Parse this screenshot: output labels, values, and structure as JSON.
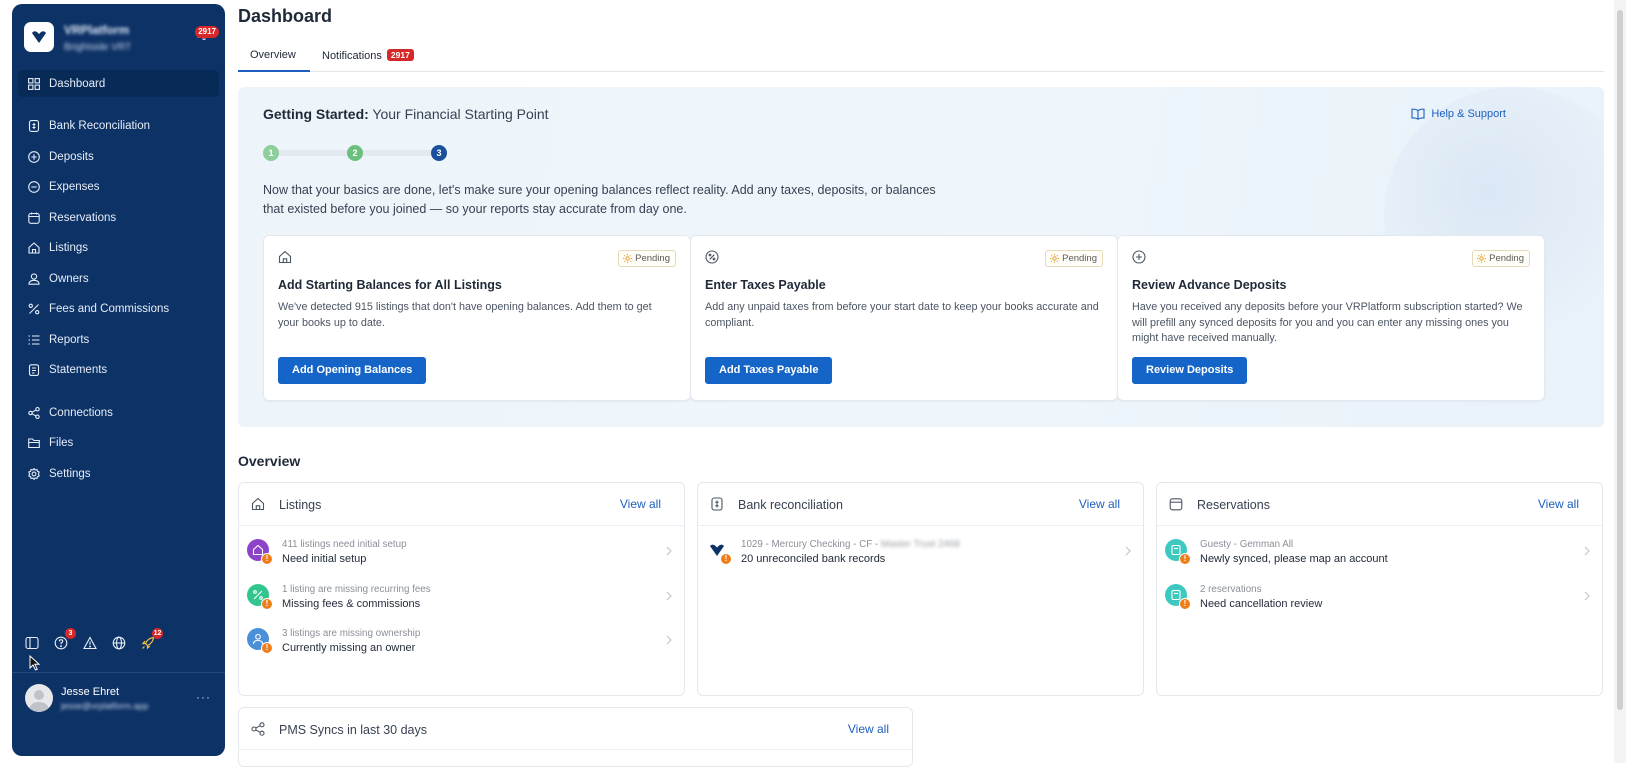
{
  "brand": {
    "name": "VRPlatform",
    "subtitle": "Brightside VRT",
    "bell_badge": "2917"
  },
  "sidebar": {
    "items": [
      {
        "label": "Dashboard",
        "icon": "grid-icon",
        "active": true
      },
      {
        "label": "Bank Reconciliation",
        "icon": "bank-icon"
      },
      {
        "label": "Deposits",
        "icon": "plus-circle-icon"
      },
      {
        "label": "Expenses",
        "icon": "minus-circle-icon"
      },
      {
        "label": "Reservations",
        "icon": "calendar-icon"
      },
      {
        "label": "Listings",
        "icon": "home-icon"
      },
      {
        "label": "Owners",
        "icon": "user-icon"
      },
      {
        "label": "Fees and Commissions",
        "icon": "percent-icon"
      },
      {
        "label": "Reports",
        "icon": "list-icon"
      },
      {
        "label": "Statements",
        "icon": "document-icon"
      },
      {
        "label": "Connections",
        "icon": "connections-icon"
      },
      {
        "label": "Files",
        "icon": "folder-icon"
      },
      {
        "label": "Settings",
        "icon": "gear-icon"
      }
    ],
    "tools": [
      {
        "icon": "panel-icon"
      },
      {
        "icon": "help-icon",
        "badge": "3"
      },
      {
        "icon": "alert-icon"
      },
      {
        "icon": "globe-icon"
      },
      {
        "icon": "rocket-icon",
        "badge": "12"
      }
    ]
  },
  "user": {
    "name": "Jesse Ehret",
    "email": "jesse@vrplatform.app",
    "more": "···"
  },
  "page": {
    "title": "Dashboard",
    "tabs": [
      {
        "label": "Overview",
        "active": true
      },
      {
        "label": "Notifications",
        "badge": "2917"
      }
    ]
  },
  "getting_started": {
    "title_bold": "Getting Started:",
    "title_rest": " Your Financial Starting Point",
    "help_label": "Help & Support",
    "steps": [
      "1",
      "2",
      "3"
    ],
    "description": "Now that your basics are done, let's make sure your opening balances reflect reality. Add any taxes, deposits, or balances that existed before you joined — so your reports stay accurate from day one.",
    "cards": [
      {
        "status": "Pending",
        "title": "Add Starting Balances for All Listings",
        "description": "We've detected 915 listings that don't have opening balances. Add them to get your books up to date.",
        "button": "Add Opening Balances"
      },
      {
        "status": "Pending",
        "title": "Enter Taxes Payable",
        "description": "Add any unpaid taxes from before your start date to keep your books accurate and compliant.",
        "button": "Add Taxes Payable"
      },
      {
        "status": "Pending",
        "title": "Review Advance Deposits",
        "description": "Have you received any deposits before your VRPlatform subscription started? We will prefill any synced deposits for you and you can enter any missing ones you might have received manually.",
        "button": "Review Deposits"
      }
    ]
  },
  "overview": {
    "title": "Overview",
    "cards": [
      {
        "title": "Listings",
        "link": "View all",
        "rows": [
          {
            "sub": "411 listings need initial setup",
            "main": "Need initial setup",
            "color": "#8e44c9"
          },
          {
            "sub": "1 listing are missing recurring fees",
            "main": "Missing fees & commissions",
            "color": "#33c58e"
          },
          {
            "sub": "3 listings are missing ownership",
            "main": "Currently missing an owner",
            "color": "#4a90d9"
          }
        ]
      },
      {
        "title": "Bank reconciliation",
        "link": "View all",
        "rows": [
          {
            "sub": "1029 - Mercury Checking - CF - ",
            "sub_blur": "Master Trust 2468",
            "main": "20 unreconciled bank records"
          }
        ]
      },
      {
        "title": "Reservations",
        "link": "View all",
        "rows": [
          {
            "sub": "Guesty - Gemman All",
            "main": "Newly synced, please map an account",
            "color": "#3dc9c0"
          },
          {
            "sub": "2 reservations",
            "main": "Need cancellation review",
            "color": "#3dc9c0"
          }
        ]
      }
    ],
    "pms": {
      "title": "PMS Syncs in last 30 days",
      "link": "View all"
    }
  },
  "colors": {
    "sidebar": "#0d3266",
    "primary_button": "#1565c9",
    "link": "#1d5fbf",
    "badge": "#d62828",
    "warning": "#ef7d1a"
  }
}
